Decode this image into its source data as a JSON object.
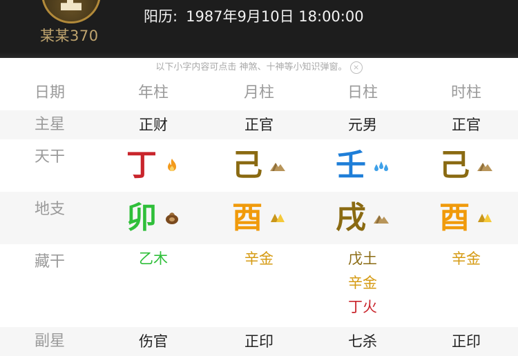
{
  "header": {
    "user_name": "某某370",
    "birth_label": "阳历:",
    "birth_value": "1987年9月10日 18:00:00"
  },
  "notice": {
    "text": "以下小字内容可点击 神煞、十神等小知识弹窗。",
    "close_symbol": "×"
  },
  "table": {
    "corner_label": "日期",
    "columns": [
      "年柱",
      "月柱",
      "日柱",
      "时柱"
    ],
    "main_star": {
      "label": "主星",
      "values": [
        "正财",
        "正官",
        "元男",
        "正官"
      ]
    },
    "heavenly_stems": {
      "label": "天干",
      "values": [
        {
          "char": "丁",
          "color": "#c9252c",
          "icon": "fire-icon"
        },
        {
          "char": "己",
          "color": "#8a6a12",
          "icon": "earth-icon"
        },
        {
          "char": "壬",
          "color": "#1e7ed8",
          "icon": "water-icon"
        },
        {
          "char": "己",
          "color": "#8a6a12",
          "icon": "earth-icon"
        }
      ]
    },
    "earthly_branches": {
      "label": "地支",
      "values": [
        {
          "char": "卯",
          "color": "#2fbf3a",
          "icon": "wood-icon"
        },
        {
          "char": "酉",
          "color": "#f09a0b",
          "icon": "metal-icon"
        },
        {
          "char": "戌",
          "color": "#8a6a12",
          "icon": "earth-icon"
        },
        {
          "char": "酉",
          "color": "#f09a0b",
          "icon": "metal-icon"
        }
      ]
    },
    "hidden_stems": {
      "label": "藏干",
      "values": [
        [
          {
            "text": "乙木",
            "color": "#2fbf3a"
          }
        ],
        [
          {
            "text": "辛金",
            "color": "#d59a12"
          }
        ],
        [
          {
            "text": "戊土",
            "color": "#8a6a12"
          },
          {
            "text": "辛金",
            "color": "#d59a12"
          },
          {
            "text": "丁火",
            "color": "#c9252c"
          }
        ],
        [
          {
            "text": "辛金",
            "color": "#d59a12"
          }
        ]
      ]
    },
    "sub_star": {
      "label": "副星",
      "values": [
        "伤官",
        "正印",
        "七杀",
        "正印"
      ]
    }
  }
}
